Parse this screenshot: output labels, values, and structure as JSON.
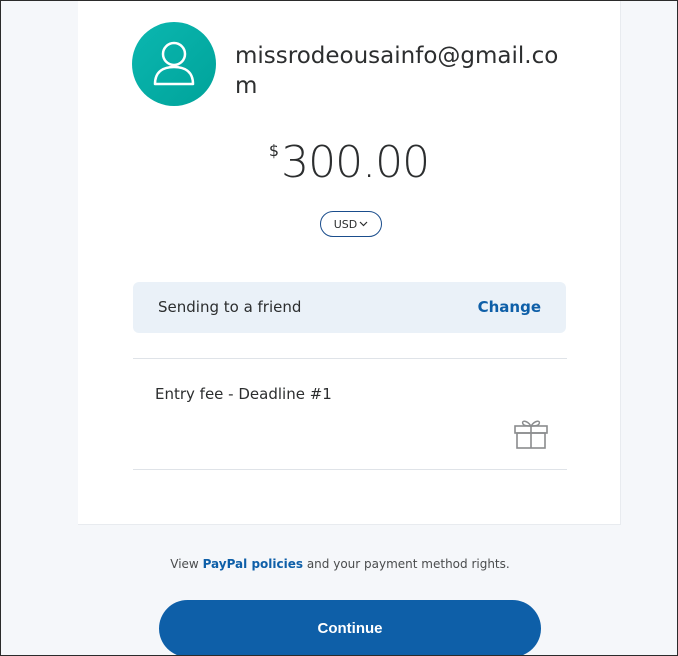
{
  "recipient": {
    "email": "missrodeousainfo@gmail.com",
    "avatar_icon": "user-icon"
  },
  "amount": {
    "currency_symbol": "$",
    "value": "300.00"
  },
  "currency_selector": {
    "selected": "USD",
    "icon": "chevron-down-icon"
  },
  "payment_type": {
    "label": "Sending to a friend",
    "change_label": "Change"
  },
  "note": {
    "text": "Entry fee - Deadline #1",
    "icon": "gift-icon"
  },
  "policy": {
    "prefix": "View ",
    "link_text": "PayPal policies",
    "suffix": " and your payment method rights."
  },
  "continue_label": "Continue",
  "colors": {
    "avatar": "#00a39a",
    "brand_blue": "#0e5fa8",
    "panel_bg": "#eaf1f8"
  }
}
